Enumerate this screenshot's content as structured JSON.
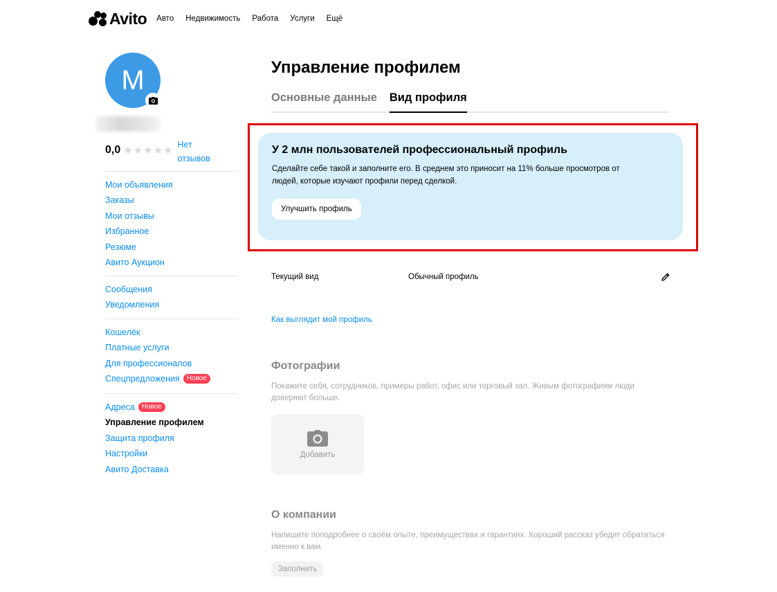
{
  "header": {
    "logo_text": "Avito",
    "nav": [
      "Авто",
      "Недвижимость",
      "Работа",
      "Услуги",
      "Ещё"
    ]
  },
  "profile": {
    "avatar_letter": "М",
    "rating": "0,0",
    "stars_filled": 0,
    "stars_total": 5,
    "reviews_line1": "Нет",
    "reviews_line2": "отзывов"
  },
  "sidebar": {
    "groups": [
      [
        {
          "label": "Мои объявления"
        },
        {
          "label": "Заказы"
        },
        {
          "label": "Мои отзывы"
        },
        {
          "label": "Избранное"
        },
        {
          "label": "Резюме"
        },
        {
          "label": "Авито Аукцион"
        }
      ],
      [
        {
          "label": "Сообщения"
        },
        {
          "label": "Уведомления"
        }
      ],
      [
        {
          "label": "Кошелёк"
        },
        {
          "label": "Платные услуги"
        },
        {
          "label": "Для профессионалов"
        },
        {
          "label": "Спецпредложения",
          "badge": "Новое"
        }
      ],
      [
        {
          "label": "Адреса",
          "badge": "Новое"
        },
        {
          "label": "Управление профилем",
          "active": true
        },
        {
          "label": "Защита профиля"
        },
        {
          "label": "Настройки"
        },
        {
          "label": "Авито Доставка"
        }
      ]
    ]
  },
  "main": {
    "title": "Управление профилем",
    "tabs": [
      {
        "label": "Основные данные",
        "active": false
      },
      {
        "label": "Вид профиля",
        "active": true
      }
    ],
    "promo": {
      "title": "У 2 млн пользователей профессиональный профиль",
      "text": "Сделайте себе такой и заполните его. В среднем это приносит на 11% больше просмотров от людей, которые изучают профили перед сделкой.",
      "button": "Улучшить профиль"
    },
    "current_view": {
      "label": "Текущий вид",
      "value": "Обычный профиль"
    },
    "profile_link": "Как выглядит мой профиль",
    "photos": {
      "title": "Фотографии",
      "text": "Покажите себя, сотрудников, примеры работ, офис или торговый зал. Живым фотографиям люди доверяют больше.",
      "add_label": "Добавить"
    },
    "company": {
      "title": "О компании",
      "text": "Напишите поподробнее о своём опыте, преимуществах и гарантиях. Хороший рассказ убедит обратиться именно к вам.",
      "button": "Заполнить"
    }
  },
  "colors": {
    "link": "#0a8ef0",
    "avatar": "#3d9ae5",
    "promo_bg": "#d6effa",
    "badge": "#ff4053",
    "highlight": "#e00000"
  }
}
